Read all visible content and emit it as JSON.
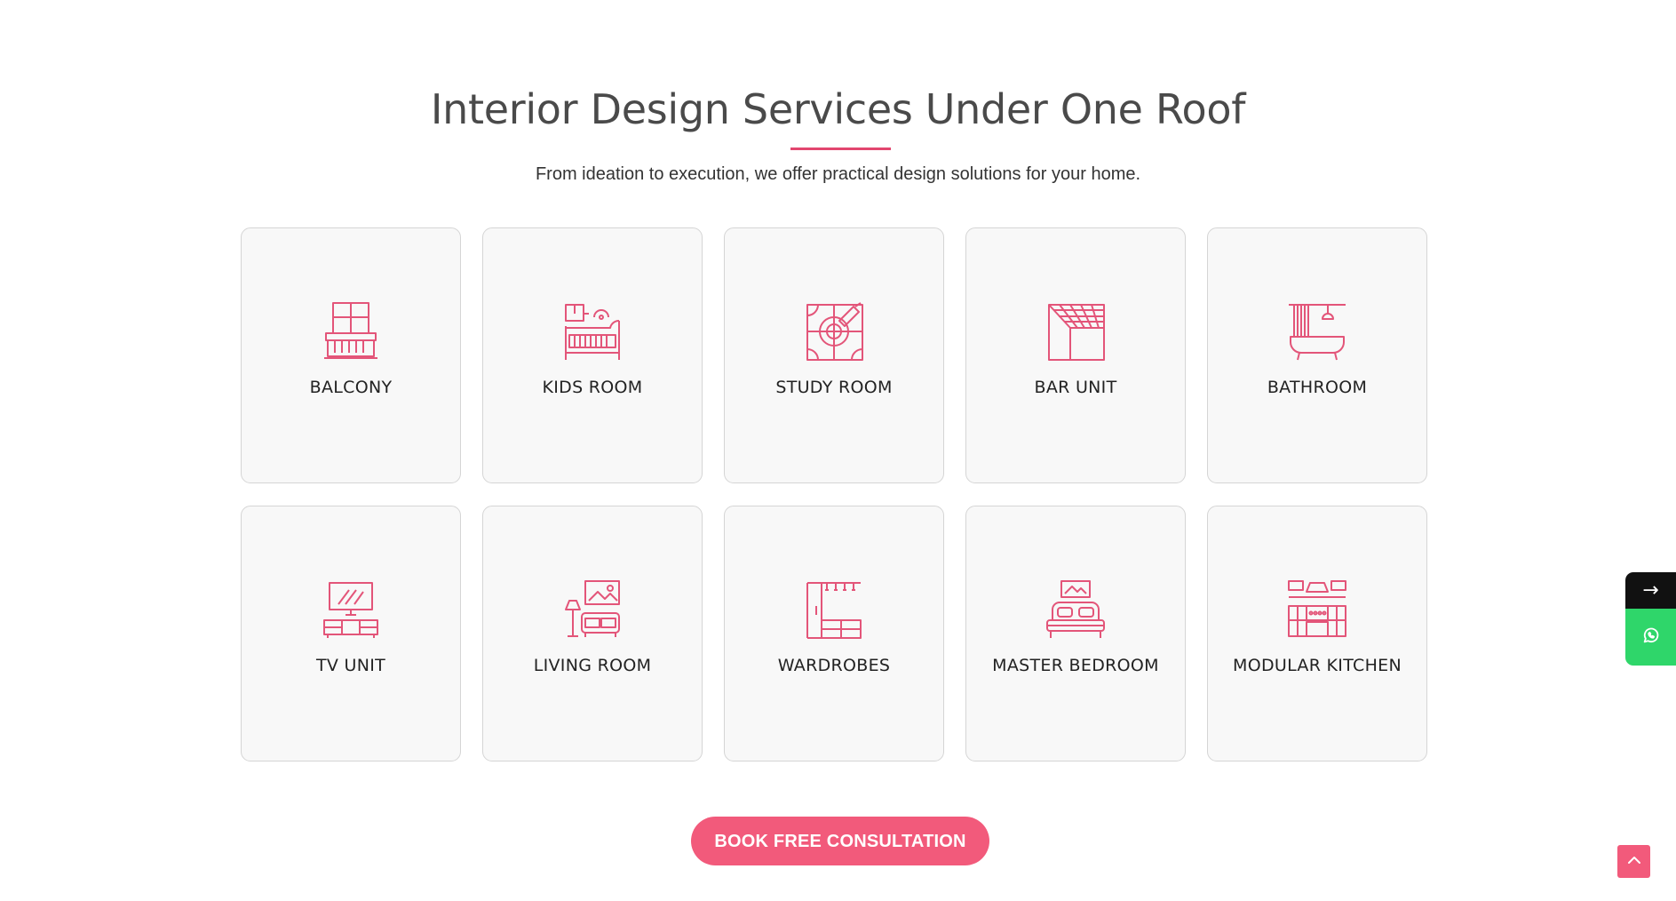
{
  "section": {
    "title": "Interior Design Services Under One Roof",
    "subtitle": "From ideation to execution, we offer practical design solutions for your home."
  },
  "services": [
    {
      "label": "BALCONY",
      "icon": "balcony-icon"
    },
    {
      "label": "KIDS ROOM",
      "icon": "crib-icon"
    },
    {
      "label": "STUDY ROOM",
      "icon": "study-design-icon"
    },
    {
      "label": "BAR UNIT",
      "icon": "bar-unit-icon"
    },
    {
      "label": "BATHROOM",
      "icon": "bathtub-icon"
    },
    {
      "label": "TV UNIT",
      "icon": "tv-unit-icon"
    },
    {
      "label": "LIVING ROOM",
      "icon": "sofa-icon"
    },
    {
      "label": "WARDROBES",
      "icon": "wardrobe-icon"
    },
    {
      "label": "MASTER BEDROOM",
      "icon": "bed-icon"
    },
    {
      "label": "MODULAR KITCHEN",
      "icon": "kitchen-icon"
    }
  ],
  "cta": {
    "label": "BOOK FREE CONSULTATION"
  },
  "floating": {
    "arrow": "→",
    "whatsapp_icon": "whatsapp-icon",
    "scroll_top_icon": "chevron-up-icon"
  },
  "colors": {
    "accent": "#f25a7b",
    "underline": "#e2466f",
    "icon_stroke": "#e35579",
    "card_bg": "#f8f8f8",
    "whatsapp": "#2fd66a"
  }
}
